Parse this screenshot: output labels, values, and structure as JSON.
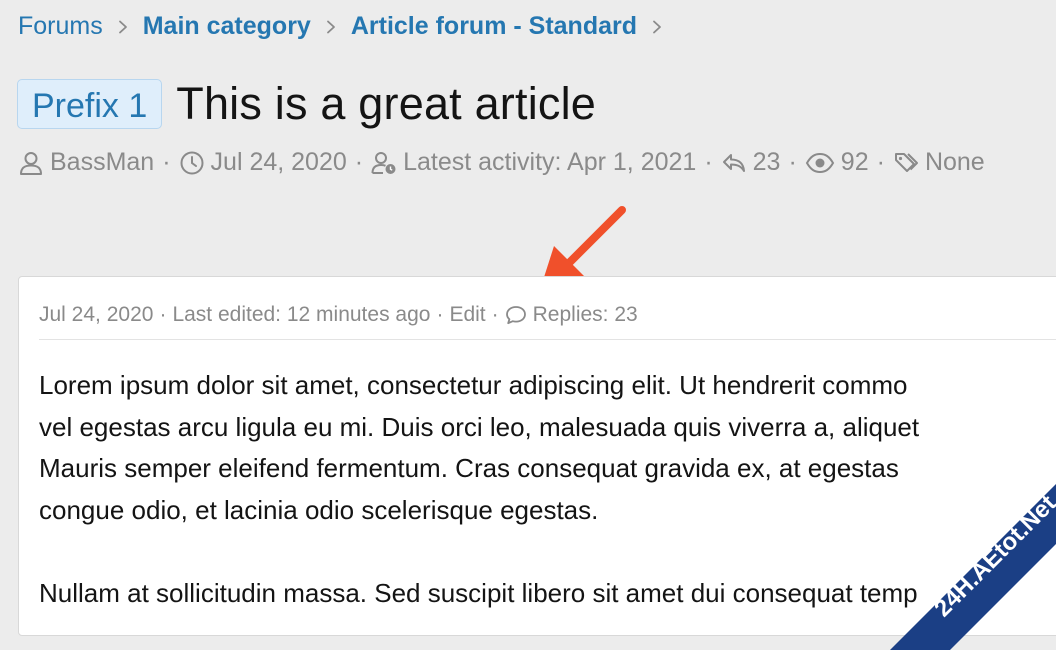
{
  "breadcrumb": {
    "items": [
      {
        "label": "Forums"
      },
      {
        "label": "Main category"
      },
      {
        "label": "Article forum - Standard"
      }
    ]
  },
  "thread": {
    "prefix": "Prefix 1",
    "title": "This is a great article"
  },
  "meta": {
    "author": "BassMan",
    "date": "Jul 24, 2020",
    "latest_activity": "Latest activity: Apr 1, 2021",
    "replies": "23",
    "views": "92",
    "tags": "None",
    "separator": "·"
  },
  "post": {
    "date": "Jul 24, 2020",
    "last_edited": "Last edited: 12 minutes ago",
    "edit_label": "Edit",
    "replies_label": "Replies: 23",
    "separator": "·",
    "body": [
      "Lorem ipsum dolor sit amet, consectetur adipiscing elit. Ut hendrerit commo",
      "vel egestas arcu ligula eu mi. Duis orci leo, malesuada quis viverra a, aliquet",
      "Mauris semper eleifend fermentum. Cras consequat gravida ex, at egestas",
      "congue odio, et lacinia odio scelerisque egestas.",
      "Nullam at sollicitudin massa. Sed suscipit libero sit amet dui consequat temp"
    ]
  },
  "watermark": {
    "text": "24H.AEtot.Net"
  },
  "colors": {
    "link": "#2577b1",
    "muted": "#8a8a8a",
    "arrow": "#f0502b",
    "prefix_bg": "#dfeefb"
  }
}
